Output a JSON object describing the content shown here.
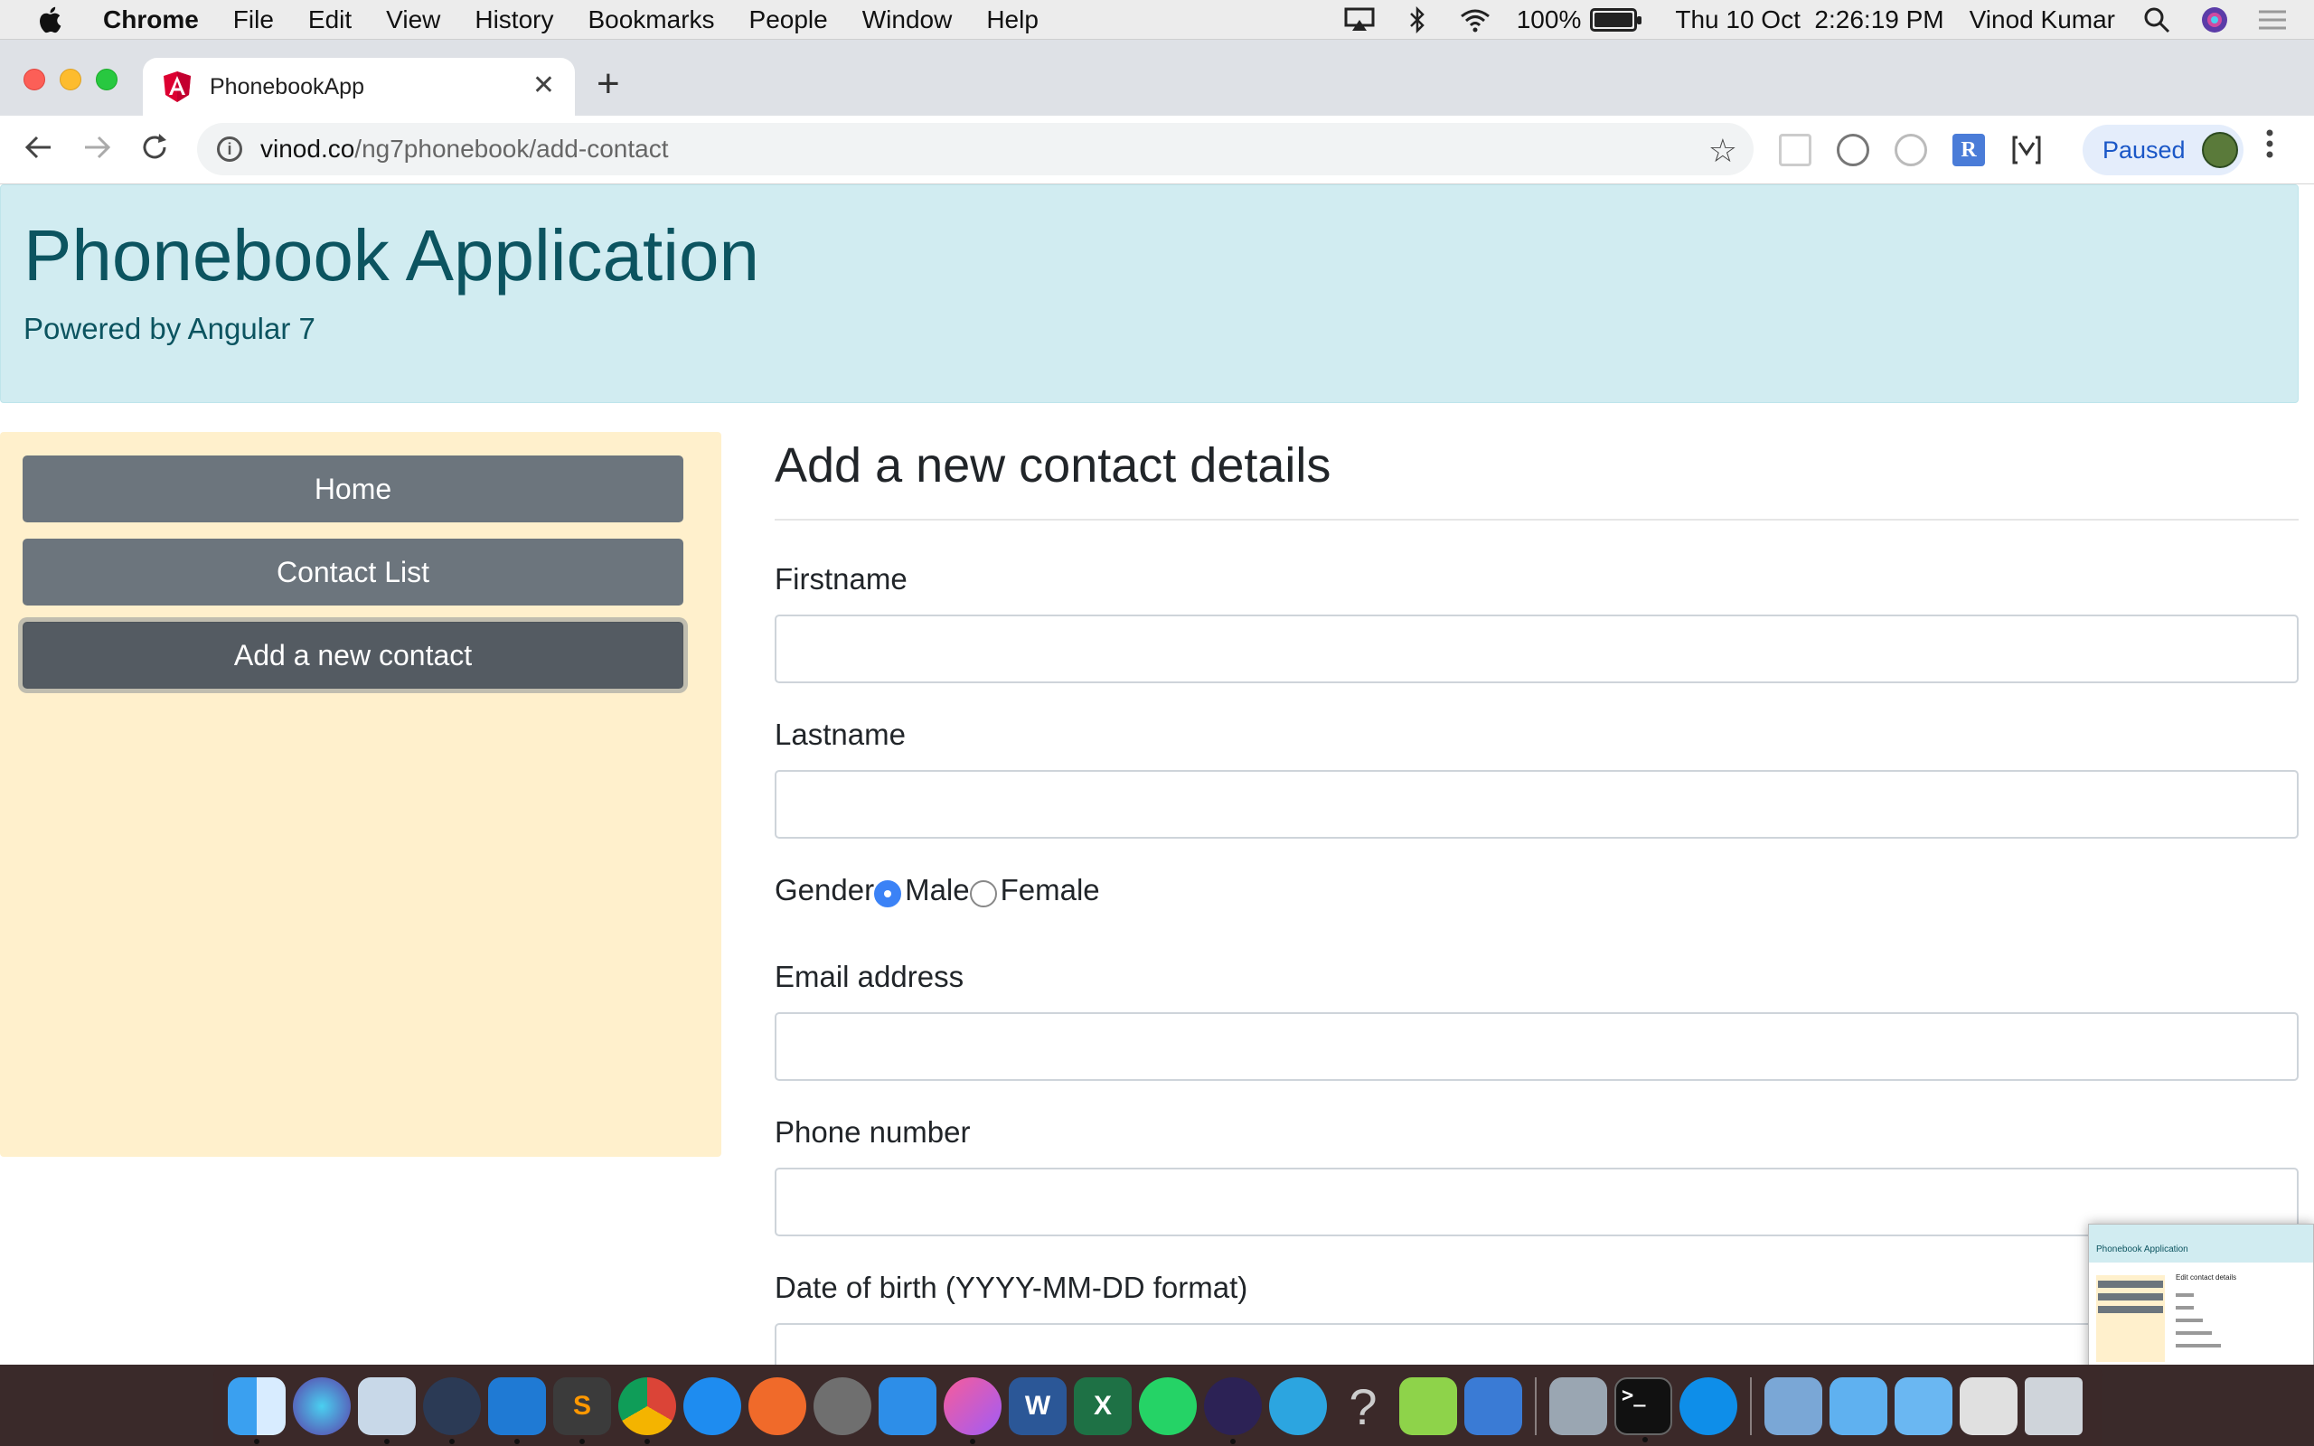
{
  "menubar": {
    "app": "Chrome",
    "menus": [
      "File",
      "Edit",
      "View",
      "History",
      "Bookmarks",
      "People",
      "Window",
      "Help"
    ],
    "battery": "100%",
    "battery_level": 1.0,
    "datetime": "Thu 10 Oct  2:26:19 PM",
    "user": "Vinod Kumar"
  },
  "browser": {
    "tab_title": "PhonebookApp",
    "new_tab_symbol": "+",
    "url_domain": "vinod.co",
    "url_path": "/ng7phonebook/add-contact",
    "ext_r_label": "R",
    "profile_status": "Paused"
  },
  "app": {
    "title": "Phonebook Application",
    "subtitle": "Powered by Angular 7"
  },
  "nav": {
    "items": [
      {
        "label": "Home",
        "active": false
      },
      {
        "label": "Contact List",
        "active": false
      },
      {
        "label": "Add a new contact",
        "active": true
      }
    ]
  },
  "form": {
    "heading": "Add a new contact details",
    "firstname_label": "Firstname",
    "firstname_value": "",
    "lastname_label": "Lastname",
    "lastname_value": "",
    "gender_label": "Gender",
    "gender_options": [
      "Male",
      "Female"
    ],
    "gender_selected": "Male",
    "email_label": "Email address",
    "email_value": "",
    "phone_label": "Phone number",
    "phone_value": "",
    "dob_label": "Date of birth (YYYY-MM-DD format)",
    "dob_value": ""
  },
  "thumbnail": {
    "title": "Phonebook Application",
    "heading": "Edit contact details"
  },
  "colors": {
    "jumbotron_bg": "#d1ecf1",
    "jumbotron_text": "#0c5460",
    "sidebar_bg": "#fff0cc",
    "nav_button": "#6c757d",
    "nav_button_active": "#545b62",
    "radio_checked": "#3b82f6"
  }
}
